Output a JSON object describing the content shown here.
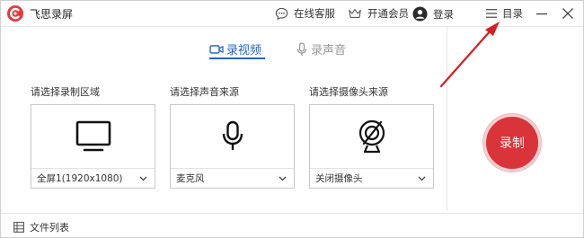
{
  "app": {
    "title": "飞思录屏",
    "accent": "#d9343a",
    "tab_color": "#2a63c8"
  },
  "toolbar": {
    "support_label": "在线客服",
    "vip_label": "开通会员",
    "login_label": "登录",
    "menu_label": "目录"
  },
  "tabs": [
    {
      "label": "录视频",
      "active": true,
      "icon": "video-camera-icon"
    },
    {
      "label": "录声音",
      "active": false,
      "icon": "microphone-icon"
    }
  ],
  "sections": [
    {
      "label": "请选择录制区域",
      "value": "全屏1(1920x1080)",
      "icon": "monitor-icon"
    },
    {
      "label": "请选择声音来源",
      "value": "麦克风",
      "icon": "microphone-icon"
    },
    {
      "label": "请选择摄像头来源",
      "value": "关闭摄像头",
      "icon": "webcam-off-icon"
    }
  ],
  "record_button": {
    "label": "录制"
  },
  "footer": {
    "file_list_label": "文件列表"
  }
}
